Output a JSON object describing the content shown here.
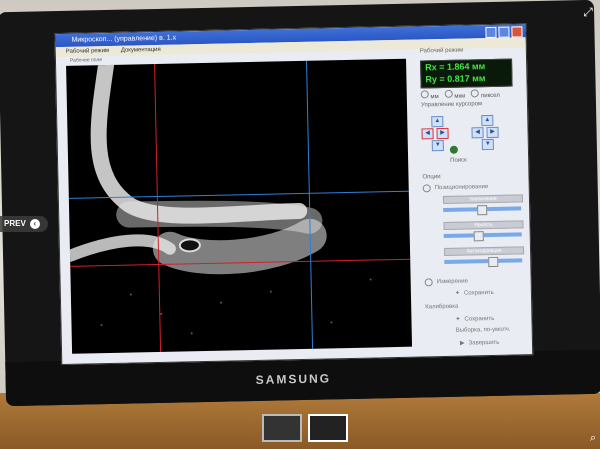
{
  "window": {
    "title": "Микроскоп... (управление) в. 1.x",
    "menu": [
      "Рабочий режим",
      "Документация"
    ]
  },
  "image_panel": {
    "label": "Рабочее поле"
  },
  "readout": {
    "section_label": "Рабочий режим",
    "rx": "Rx = 1.864 мм",
    "ry": "Ry = 0.817 мм",
    "units": [
      "мм",
      "мкм",
      "пиксел"
    ]
  },
  "cursor_control": {
    "label": "Управление курсором",
    "home_label": "Поиск"
  },
  "options": {
    "label": "Опции",
    "positioning_label": "Позиционирование",
    "bars": [
      "Увеличение",
      "Яркость",
      "Автокоррекция"
    ]
  },
  "actions": {
    "measure_label": "Измерение",
    "save_label": "Сохранить",
    "calibrate_label": "Калибровка",
    "save2_label": "Сохранить",
    "default_label": "Выборка, по-умолч.",
    "finish_label": "Завершить"
  },
  "monitor": {
    "brand": "SAMSUNG"
  },
  "viewer": {
    "prev_label": "PREV",
    "expand_icon": "expand-icon",
    "zoom_icon": "zoom-icon"
  },
  "colors": {
    "crosshair_red": "#d0202a",
    "crosshair_blue": "#2f7fd8",
    "readout_green": "#45e345"
  }
}
